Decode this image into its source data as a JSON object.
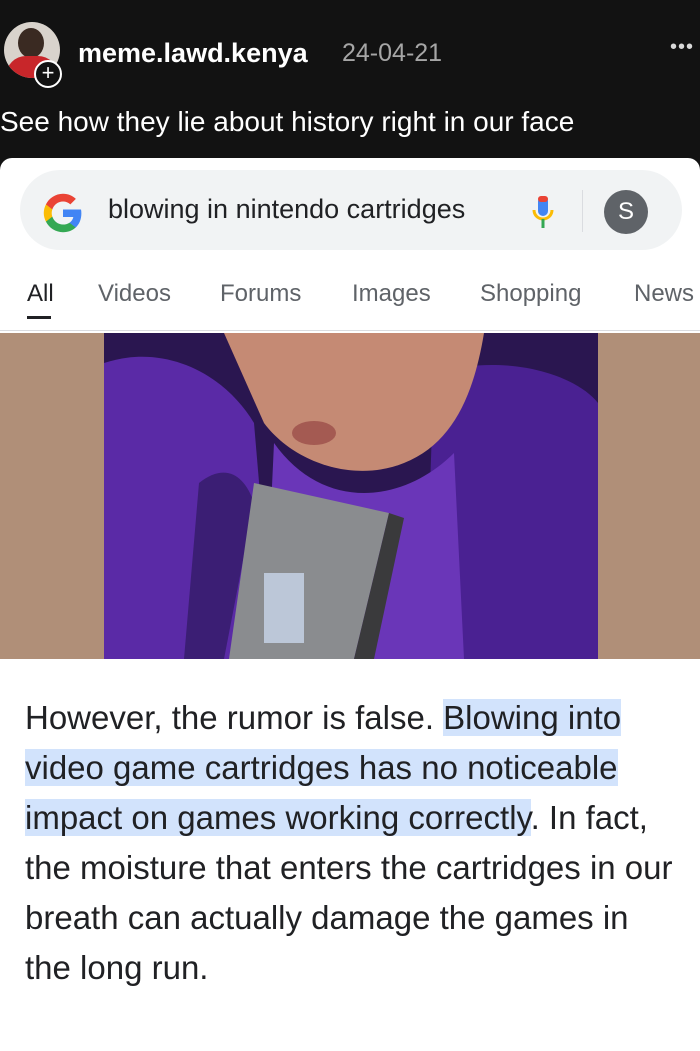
{
  "post": {
    "username": "meme.lawd.kenya",
    "date": "24-04-21",
    "caption": "See how they lie about history right in our face",
    "more_label": "•••",
    "follow_badge": "+"
  },
  "search": {
    "query": "blowing in nintendo cartridges",
    "profile_initial": "S"
  },
  "tabs": [
    {
      "label": "All",
      "active": true
    },
    {
      "label": "Videos"
    },
    {
      "label": "Forums"
    },
    {
      "label": "Images"
    },
    {
      "label": "Shopping"
    },
    {
      "label": "News"
    }
  ],
  "result": {
    "text_before": "However, the rumor is false. ",
    "text_highlight": "Blowing into video game cartridges has no noticeable impact on games working correctly",
    "text_after": ". In fact, the moisture that enters the cartridges in our breath can actually damage the games in the long run."
  },
  "colors": {
    "highlight": "#d2e3fc",
    "tab_active": "#202124",
    "tab_inactive": "#5f6368"
  }
}
